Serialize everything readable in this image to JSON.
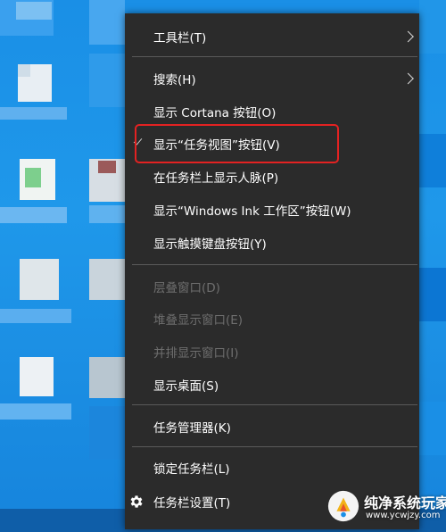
{
  "context_menu": {
    "items": [
      {
        "label": "工具栏(T)"
      },
      {
        "label": "搜索(H)"
      },
      {
        "label": "显示 Cortana 按钮(O)"
      },
      {
        "label": "显示“任务视图”按钮(V)"
      },
      {
        "label": "在任务栏上显示人脉(P)"
      },
      {
        "label": "显示“Windows Ink 工作区”按钮(W)"
      },
      {
        "label": "显示触摸键盘按钮(Y)"
      },
      {
        "label": "层叠窗口(D)"
      },
      {
        "label": "堆叠显示窗口(E)"
      },
      {
        "label": "并排显示窗口(I)"
      },
      {
        "label": "显示桌面(S)"
      },
      {
        "label": "任务管理器(K)"
      },
      {
        "label": "锁定任务栏(L)"
      },
      {
        "label": "任务栏设置(T)"
      }
    ]
  },
  "watermark": {
    "title": "纯净系统玩家",
    "url": "www.ycwjzy.com"
  },
  "colors": {
    "menu_bg": "#2b2b2b",
    "highlight_border": "#e32222",
    "desktop_blue": "#1a8fe6"
  }
}
